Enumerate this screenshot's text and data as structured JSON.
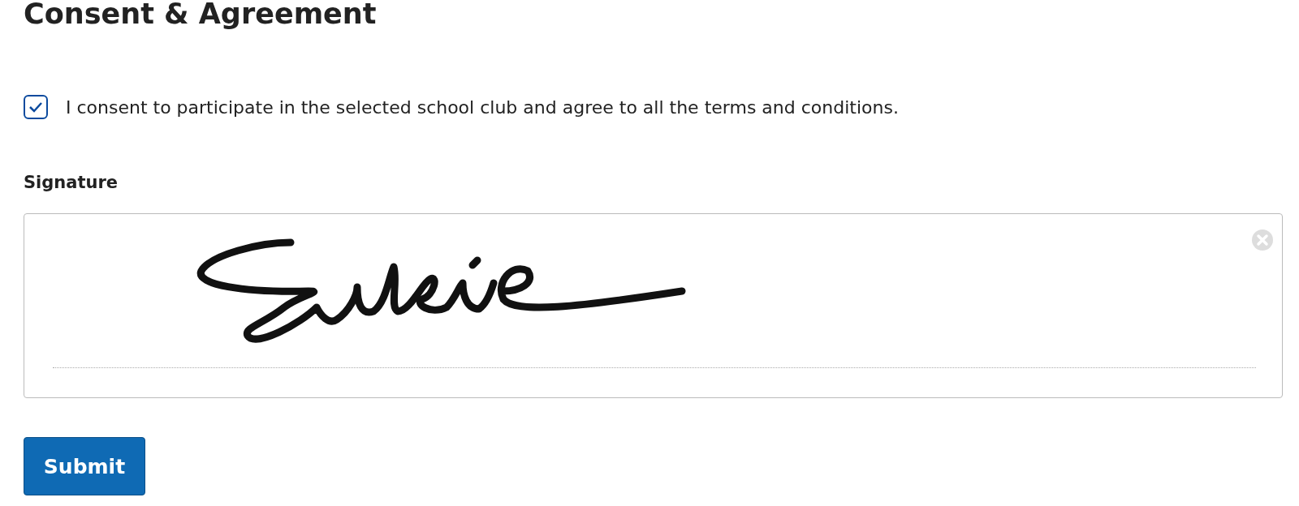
{
  "heading": "Consent & Agreement",
  "consent": {
    "label": "I consent to participate in the selected school club and agree to all the terms and conditions.",
    "checked": true
  },
  "signature": {
    "label": "Signature",
    "signed": true
  },
  "submit": "Submit"
}
